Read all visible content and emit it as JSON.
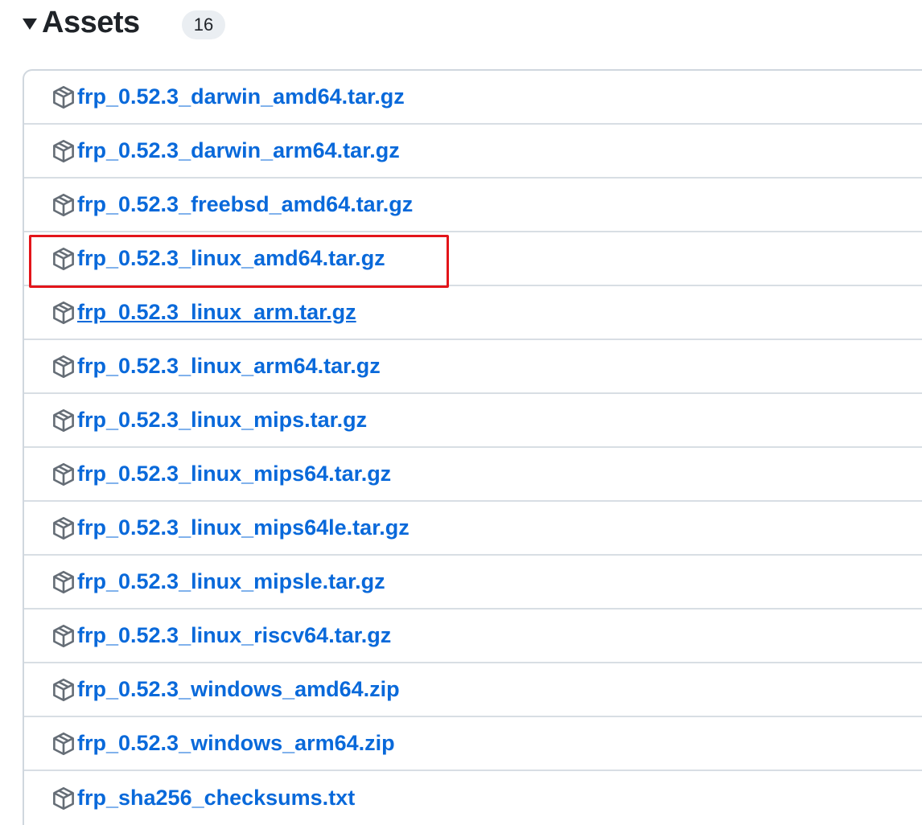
{
  "assets": {
    "title": "Assets",
    "count": "16",
    "items": [
      {
        "name": "frp_0.52.3_darwin_amd64.tar.gz",
        "icon": "package-icon"
      },
      {
        "name": "frp_0.52.3_darwin_arm64.tar.gz",
        "icon": "package-icon"
      },
      {
        "name": "frp_0.52.3_freebsd_amd64.tar.gz",
        "icon": "package-icon"
      },
      {
        "name": "frp_0.52.3_linux_amd64.tar.gz",
        "icon": "package-icon",
        "highlighted": true
      },
      {
        "name": "frp_0.52.3_linux_arm.tar.gz",
        "icon": "package-icon",
        "hovered": true
      },
      {
        "name": "frp_0.52.3_linux_arm64.tar.gz",
        "icon": "package-icon"
      },
      {
        "name": "frp_0.52.3_linux_mips.tar.gz",
        "icon": "package-icon"
      },
      {
        "name": "frp_0.52.3_linux_mips64.tar.gz",
        "icon": "package-icon"
      },
      {
        "name": "frp_0.52.3_linux_mips64le.tar.gz",
        "icon": "package-icon"
      },
      {
        "name": "frp_0.52.3_linux_mipsle.tar.gz",
        "icon": "package-icon"
      },
      {
        "name": "frp_0.52.3_linux_riscv64.tar.gz",
        "icon": "package-icon"
      },
      {
        "name": "frp_0.52.3_windows_amd64.zip",
        "icon": "package-icon"
      },
      {
        "name": "frp_0.52.3_windows_arm64.zip",
        "icon": "package-icon"
      },
      {
        "name": "frp_sha256_checksums.txt",
        "icon": "package-icon"
      }
    ]
  },
  "colors": {
    "link": "#0969da",
    "text": "#1f2328",
    "border": "#d0d7de",
    "counter_bg": "#eaeef2",
    "icon": "#656d76",
    "highlight": "#e3151a"
  }
}
